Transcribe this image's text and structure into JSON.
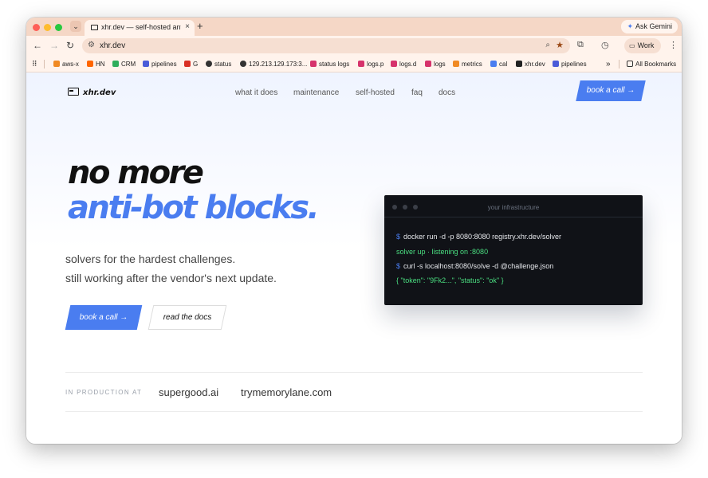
{
  "browser": {
    "tab_title": "xhr.dev — self-hosted anti-bo",
    "tab_close": "×",
    "new_tab": "+",
    "ask_gemini": "Ask Gemini",
    "url": "xhr.dev",
    "profile": "Work",
    "bookmarks": [
      {
        "label": "aws-x",
        "color": "#f08a24"
      },
      {
        "label": "HN",
        "color": "#ff6600"
      },
      {
        "label": "CRM",
        "color": "#2eae5c"
      },
      {
        "label": "pipelines",
        "color": "#4a5bd8"
      },
      {
        "label": "G",
        "color": "#d93025"
      },
      {
        "label": "status",
        "color": "#333333"
      },
      {
        "label": "129.213.129.173:3...",
        "color": "#333333"
      },
      {
        "label": "status logs",
        "color": "#d6336c"
      },
      {
        "label": "logs.p",
        "color": "#d6336c"
      },
      {
        "label": "logs.d",
        "color": "#d6336c"
      },
      {
        "label": "logs",
        "color": "#d6336c"
      },
      {
        "label": "metrics",
        "color": "#f08a24"
      },
      {
        "label": "cal",
        "color": "#4a7df0"
      },
      {
        "label": "xhr.dev",
        "color": "#222222"
      },
      {
        "label": "pipelines",
        "color": "#4a5bd8"
      }
    ],
    "bookmarks_more": "»",
    "all_bookmarks": "All Bookmarks"
  },
  "site": {
    "logo": "xhr.dev",
    "nav": [
      "what it does",
      "maintenance",
      "self-hosted",
      "faq",
      "docs"
    ],
    "book_call_top": "book a call →",
    "hero_line1": "no more",
    "hero_line2": "anti-bot blocks.",
    "subtitle_1": "solvers for the hardest challenges.",
    "subtitle_2": "still working after the vendor's next update.",
    "cta_primary": "book a call →",
    "cta_secondary": "read the docs",
    "terminal": {
      "title": "your infrastructure",
      "prompt": "$",
      "line1": "docker run -d -p 8080:8080 registry.xhr.dev/solver",
      "line2": "solver up · listening on :8080",
      "line3": "curl -s localhost:8080/solve -d @challenge.json",
      "line4": "{ \"token\": \"9Fk2...\", \"status\": \"ok\" }"
    },
    "production_label": "IN PRODUCTION AT",
    "clients": [
      "supergood.ai",
      "trymemorylane.com"
    ]
  },
  "colors": {
    "accent": "#4a7df0",
    "terminal_bg": "#101217",
    "terminal_green": "#4ade80",
    "tab_strip": "#f5d7c6"
  }
}
